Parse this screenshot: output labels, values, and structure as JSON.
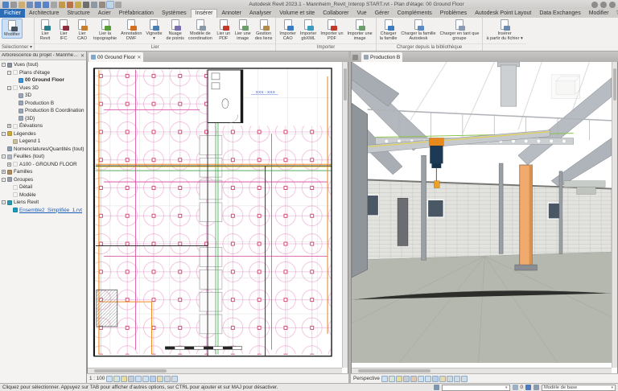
{
  "window": {
    "title": "Autodesk Revit 2023.1 - Mannheim_Revit_Interop START.rvt - Plan d'étage: 00 Ground Floor"
  },
  "quick_access": [
    {
      "name": "revit-logo-icon",
      "c": "#2f6fc0"
    },
    {
      "name": "file-menu-icon",
      "c": "#8a8a8a"
    },
    {
      "name": "open-icon",
      "c": "#caa45a"
    },
    {
      "name": "save-icon",
      "c": "#5a7ab0"
    },
    {
      "name": "undo-icon",
      "c": "#3a6fc0"
    },
    {
      "name": "redo-icon",
      "c": "#3a6fc0"
    },
    {
      "name": "print-icon",
      "c": "#9a9a9a"
    },
    {
      "name": "measure-icon",
      "c": "#c08a2a"
    },
    {
      "name": "aligned-dimension-icon",
      "c": "#b05a2a"
    },
    {
      "name": "tag-icon",
      "c": "#c0a030"
    },
    {
      "name": "text-icon",
      "c": "#555555"
    },
    {
      "name": "default-3d-view-icon",
      "c": "#7a8a9a"
    },
    {
      "name": "section-icon",
      "c": "#88776a"
    },
    {
      "name": "thin-lines-icon",
      "c": "#3a6fc0",
      "flags": [
        "hl"
      ]
    },
    {
      "name": "switch-windows-icon",
      "c": "#9a9a9a"
    }
  ],
  "title_icons": [
    {
      "name": "search-icon"
    },
    {
      "name": "user-avatar-icon"
    },
    {
      "name": "help-icon"
    }
  ],
  "ribbon": {
    "tabs": [
      {
        "label": "Fichier",
        "flags": [
          "file"
        ]
      },
      {
        "label": "Architecture"
      },
      {
        "label": "Structure"
      },
      {
        "label": "Acier"
      },
      {
        "label": "Préfabrication"
      },
      {
        "label": "Systèmes"
      },
      {
        "label": "Insérer",
        "flags": [
          "active"
        ]
      },
      {
        "label": "Annoter"
      },
      {
        "label": "Analyser"
      },
      {
        "label": "Volume et site"
      },
      {
        "label": "Collaborer"
      },
      {
        "label": "Vue"
      },
      {
        "label": "Gérer"
      },
      {
        "label": "Compléments"
      },
      {
        "label": "Problèmes"
      },
      {
        "label": "Autodesk Point Layout"
      },
      {
        "label": "Data Exchanges"
      },
      {
        "label": "Modifier"
      }
    ],
    "help_glyph": "?",
    "groups": [
      {
        "label": "Sélectionner ▾",
        "buttons": [
          {
            "label": "Modifier",
            "name": "modify-button",
            "icon_name": "modify-cursor-icon",
            "c": "#4a5560",
            "flags": [
              "hl"
            ]
          }
        ]
      },
      {
        "label": "Lier",
        "buttons": [
          {
            "label": "Lier\nRevit",
            "name": "link-revit-button",
            "icon_name": "link-revit-icon",
            "c": "#2e7d8c"
          },
          {
            "label": "Lier\nIFC",
            "name": "link-ifc-button",
            "icon_name": "link-ifc-icon",
            "c": "#8c2e3e"
          },
          {
            "label": "Lier\nCAO",
            "name": "link-cad-button",
            "icon_name": "link-cad-icon",
            "c": "#c77f2e"
          },
          {
            "label": "Lier la\ntopographie",
            "name": "link-topography-button",
            "icon_name": "link-topography-icon",
            "c": "#5a9e3a"
          },
          {
            "label": "Annotation\nDWF",
            "name": "dwf-markup-button",
            "icon_name": "dwf-markup-icon",
            "c": "#d07020"
          },
          {
            "label": "Vignette\n▾",
            "name": "decal-button",
            "icon_name": "decal-icon",
            "c": "#4a7fb5"
          },
          {
            "label": "Nuage\nde points",
            "name": "point-cloud-button",
            "icon_name": "point-cloud-icon",
            "c": "#7a6fb0"
          },
          {
            "label": "Modèle de\ncoordination",
            "name": "coordination-model-button",
            "icon_name": "coordination-model-icon",
            "c": "#8a9aa5"
          },
          {
            "label": "Lier un\nPDF",
            "name": "link-pdf-button",
            "icon_name": "link-pdf-icon",
            "c": "#c0392b"
          },
          {
            "label": "Lier une\nimage",
            "name": "link-image-button",
            "icon_name": "link-image-icon",
            "c": "#6a9e6a"
          },
          {
            "label": "Gestion\ndes liens",
            "name": "manage-links-button",
            "icon_name": "manage-links-icon",
            "c": "#b08a4a"
          }
        ]
      },
      {
        "label": "Importer",
        "buttons": [
          {
            "label": "Importer\nCAO",
            "name": "import-cad-button",
            "icon_name": "import-cad-icon",
            "c": "#3a7ac0"
          },
          {
            "label": "Importer\ngbXML",
            "name": "import-gbxml-button",
            "icon_name": "import-gbxml-icon",
            "c": "#3a9ac0"
          },
          {
            "label": "Importer un\nPDF",
            "name": "import-pdf-button",
            "icon_name": "import-pdf-icon",
            "c": "#c0392b"
          },
          {
            "label": "Importer une\nimage",
            "name": "import-image-button",
            "icon_name": "import-image-icon",
            "c": "#6a9e6a"
          }
        ]
      },
      {
        "label": "Charger depuis la bibliothèque",
        "buttons": [
          {
            "label": "Charger\nla famille",
            "name": "load-family-button",
            "icon_name": "load-family-icon",
            "c": "#3a7ac0"
          },
          {
            "label": "Charger la famille\nAutodesk",
            "name": "load-autodesk-family-button",
            "icon_name": "load-autodesk-family-icon",
            "c": "#5a8ac0"
          },
          {
            "label": "Charger en tant que\ngroupe",
            "name": "load-as-group-button",
            "icon_name": "load-as-group-icon",
            "c": "#8a9ab0"
          }
        ]
      },
      {
        "label": "",
        "buttons": [
          {
            "label": "Insérer\nà partir du fichier ▾",
            "name": "insert-from-file-button",
            "icon_name": "insert-from-file-icon",
            "c": "#6a8ab0"
          }
        ]
      }
    ]
  },
  "browser": {
    "title": "Arborescence du projet - Mannheim_Re...",
    "close_glyph": "✕",
    "items": [
      {
        "d": 0,
        "e": "-",
        "i": "views-icon",
        "c": "#8a929e",
        "label": "Vues (tout)"
      },
      {
        "d": 1,
        "e": "-",
        "c": "transparent",
        "label": "Plans d'étage"
      },
      {
        "d": 2,
        "e": "",
        "i": "plan-view-icon",
        "c": "#3f8fd4",
        "label": "00 Ground Floor",
        "flags": [
          "bold"
        ]
      },
      {
        "d": 1,
        "e": "-",
        "c": "transparent",
        "label": "Vues 3D"
      },
      {
        "d": 2,
        "e": "",
        "i": "view3d-icon",
        "c": "#9aa6b4",
        "label": "3D"
      },
      {
        "d": 2,
        "e": "",
        "i": "view3d-icon",
        "c": "#9aa6b4",
        "label": "Production B"
      },
      {
        "d": 2,
        "e": "",
        "i": "view3d-icon",
        "c": "#9aa6b4",
        "label": "Production B Coordination"
      },
      {
        "d": 2,
        "e": "",
        "i": "view3d-icon",
        "c": "#9aa6b4",
        "label": "{3D}"
      },
      {
        "d": 1,
        "e": "+",
        "c": "transparent",
        "label": "Élévations"
      },
      {
        "d": 0,
        "e": "-",
        "i": "legends-icon",
        "c": "#caa83c",
        "label": "Légendes"
      },
      {
        "d": 1,
        "e": "",
        "i": "legend-item-icon",
        "c": "#c8c09a",
        "label": "Legend 1"
      },
      {
        "d": 0,
        "e": "",
        "i": "schedules-icon",
        "c": "#8aa0b4",
        "label": "Nomenclatures/Quantités (tout)"
      },
      {
        "d": 0,
        "e": "-",
        "i": "sheets-icon",
        "c": "#b0b8c4",
        "label": "Feuilles (tout)"
      },
      {
        "d": 1,
        "e": "+",
        "c": "transparent",
        "label": "A100 - GROUND FLOOR"
      },
      {
        "d": 0,
        "e": "+",
        "i": "families-icon",
        "c": "#b08a5a",
        "label": "Familles"
      },
      {
        "d": 0,
        "e": "-",
        "i": "groups-icon",
        "c": "#98a0a8",
        "label": "Groupes"
      },
      {
        "d": 1,
        "e": "",
        "c": "transparent",
        "label": "Détail"
      },
      {
        "d": 1,
        "e": "",
        "c": "transparent",
        "label": "Modèle"
      },
      {
        "d": 0,
        "e": "-",
        "i": "revit-links-icon",
        "c": "#2a9ab0",
        "label": "Liens Revit"
      },
      {
        "d": 1,
        "e": "",
        "i": "revit-link-file-icon",
        "c": "#1a9bb8",
        "label": "Ensemble2_Simplifiée_1.rvt",
        "flags": [
          "sel"
        ]
      }
    ]
  },
  "views": {
    "plan_tab": "00 Ground Floor",
    "plan_tab_close": "✕",
    "view3d_tab": "Production B",
    "plan_annotation": "XXX - XXX"
  },
  "plan_bar": {
    "scale": "1 : 100",
    "icons": [
      {
        "name": "detail-level-icon",
        "c": "#cfe0f0"
      },
      {
        "name": "visual-style-icon",
        "c": "#d8e4d8"
      },
      {
        "name": "sun-path-icon",
        "c": "#eadc9a"
      },
      {
        "name": "shadows-icon",
        "c": "#c8ccd4"
      },
      {
        "name": "crop-view-icon",
        "c": "#cfe0f0"
      },
      {
        "name": "crop-region-visibility-icon",
        "c": "#cfe0f0"
      },
      {
        "name": "temporary-hide-isolate-icon",
        "c": "#b8d0ea"
      },
      {
        "name": "reveal-hidden-elements-icon",
        "c": "#e8d8b0"
      },
      {
        "name": "temporary-view-properties-icon",
        "c": "#d4d8dc"
      },
      {
        "name": "reveal-constraints-icon",
        "c": "#d0dce8"
      }
    ]
  },
  "view3d_bar": {
    "mode": "Perspective",
    "icons": [
      {
        "name": "detail-level-icon",
        "c": "#cfe0f0"
      },
      {
        "name": "visual-style-icon",
        "c": "#d8e4d8"
      },
      {
        "name": "sun-path-icon",
        "c": "#eadc9a"
      },
      {
        "name": "shadows-icon",
        "c": "#c8ccd4"
      },
      {
        "name": "rendering-dialog-icon",
        "c": "#e0c8b0"
      },
      {
        "name": "crop-view-icon",
        "c": "#cfe0f0"
      },
      {
        "name": "crop-region-visibility-icon",
        "c": "#cfe0f0"
      },
      {
        "name": "temporary-hide-isolate-icon",
        "c": "#b8d0ea"
      },
      {
        "name": "reveal-hidden-elements-icon",
        "c": "#e8d8b0"
      },
      {
        "name": "temporary-view-properties-icon",
        "c": "#d4d8dc"
      },
      {
        "name": "displacement-sets-icon",
        "c": "#d0dce8"
      },
      {
        "name": "reveal-constraints-icon",
        "c": "#d0dce8"
      }
    ]
  },
  "statusbar": {
    "message": "Cliquez pour sélectionner. Appuyez sur TAB pour afficher d'autres options, sur CTRL pour ajouter et sur MAJ pour désactiver.",
    "workset_value": "",
    "selection_count": "0",
    "design_option": "Modèle de base",
    "dropdown_glyph": "▾"
  }
}
